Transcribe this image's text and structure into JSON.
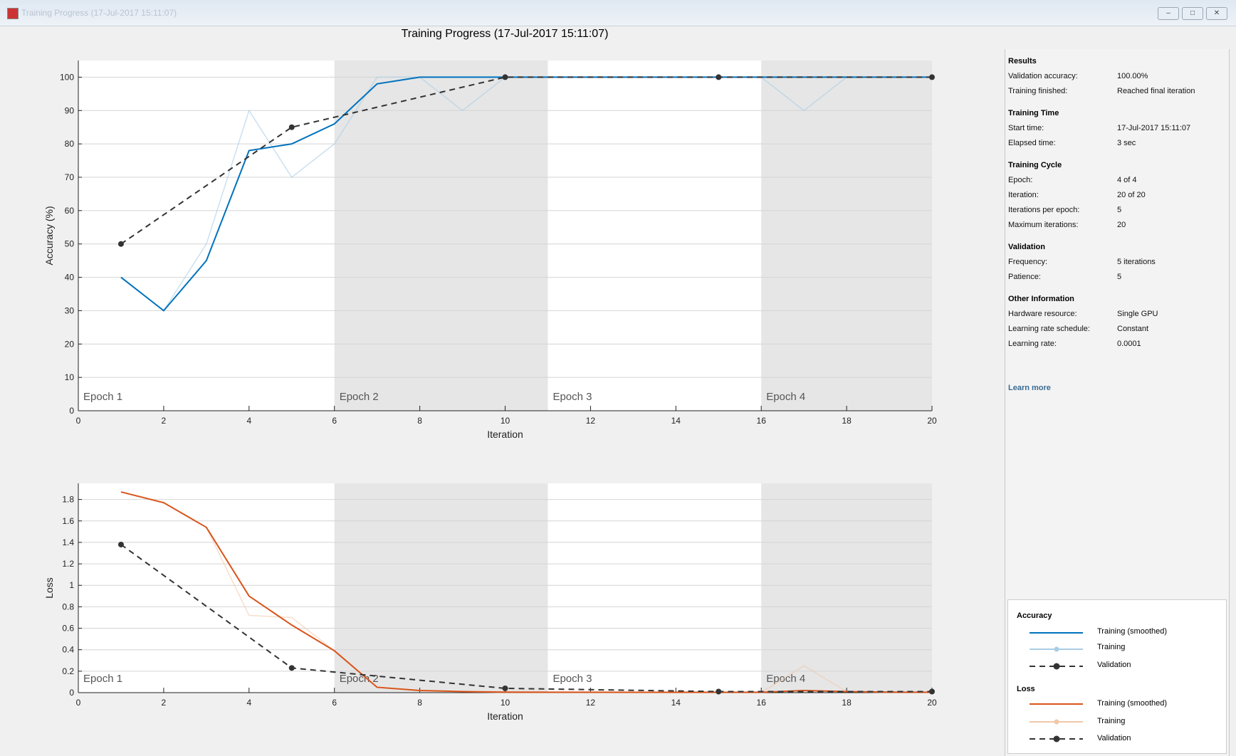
{
  "window": {
    "title": "Training Progress (17-Jul-2017 15:11:07)",
    "buttons": [
      "minimize",
      "maximize",
      "close"
    ]
  },
  "results": {
    "sections": [
      {
        "title": "Results",
        "rows": [
          [
            "Validation accuracy:",
            "100.00%"
          ],
          [
            "Training finished:",
            "Reached final iteration"
          ]
        ]
      },
      {
        "title": "Training Time",
        "rows": [
          [
            "Start time:",
            "17-Jul-2017 15:11:07"
          ],
          [
            "Elapsed time:",
            "3 sec"
          ]
        ]
      },
      {
        "title": "Training Cycle",
        "rows": [
          [
            "Epoch:",
            "4 of 4"
          ],
          [
            "Iteration:",
            "20 of 20"
          ],
          [
            "Iterations per epoch:",
            "5"
          ],
          [
            "Maximum iterations:",
            "20"
          ]
        ]
      },
      {
        "title": "Validation",
        "rows": [
          [
            "Frequency:",
            "5 iterations"
          ],
          [
            "Patience:",
            "5"
          ]
        ]
      },
      {
        "title": "Other Information",
        "rows": [
          [
            "Hardware resource:",
            "Single GPU"
          ],
          [
            "Learning rate schedule:",
            "Constant"
          ],
          [
            "Learning rate:",
            "0.0001"
          ]
        ]
      }
    ],
    "learn_more": "Learn more"
  },
  "legend": {
    "accuracy_title": "Accuracy",
    "loss_title": "Loss",
    "items": [
      "Training (smoothed)",
      "Training",
      "Validation"
    ],
    "colors": {
      "acc_smooth": "#0072bd",
      "acc_raw": "#a9cde6",
      "loss_smooth": "#d95319",
      "loss_raw": "#f0c8a8",
      "validation": "#333333"
    }
  },
  "chart_data": [
    {
      "type": "line",
      "title": "Training Progress (17-Jul-2017 15:11:07)",
      "xlabel": "Iteration",
      "ylabel": "Accuracy (%)",
      "xlim": [
        0,
        20
      ],
      "ylim": [
        0,
        105
      ],
      "xticks": [
        0,
        2,
        4,
        6,
        8,
        10,
        12,
        14,
        16,
        18,
        20
      ],
      "yticks": [
        0,
        10,
        20,
        30,
        40,
        50,
        60,
        70,
        80,
        90,
        100
      ],
      "epochs": [
        "Epoch 1",
        "Epoch 2",
        "Epoch 3",
        "Epoch 4"
      ],
      "series": [
        {
          "name": "Training (smoothed)",
          "x": [
            1,
            2,
            3,
            4,
            5,
            6,
            7,
            8,
            9,
            10,
            11,
            12,
            13,
            14,
            15,
            16,
            17,
            18,
            19,
            20
          ],
          "y": [
            40,
            30,
            45,
            78,
            80,
            86,
            98,
            100,
            100,
            100,
            100,
            100,
            100,
            100,
            100,
            100,
            100,
            100,
            100,
            100
          ]
        },
        {
          "name": "Training",
          "x": [
            1,
            2,
            3,
            4,
            5,
            6,
            7,
            8,
            9,
            10,
            11,
            12,
            13,
            14,
            15,
            16,
            17,
            18,
            19,
            20
          ],
          "y": [
            40,
            30,
            50,
            90,
            70,
            80,
            100,
            100,
            90,
            100,
            100,
            100,
            100,
            100,
            100,
            100,
            90,
            100,
            100,
            100
          ]
        },
        {
          "name": "Validation",
          "x": [
            1,
            5,
            10,
            15,
            20
          ],
          "y": [
            50,
            85,
            100,
            100,
            100
          ]
        }
      ]
    },
    {
      "type": "line",
      "xlabel": "Iteration",
      "ylabel": "Loss",
      "xlim": [
        0,
        20
      ],
      "ylim": [
        0,
        1.95
      ],
      "xticks": [
        0,
        2,
        4,
        6,
        8,
        10,
        12,
        14,
        16,
        18,
        20
      ],
      "yticks": [
        0,
        0.2,
        0.4,
        0.6,
        0.8,
        1,
        1.2,
        1.4,
        1.6,
        1.8
      ],
      "epochs": [
        "Epoch 1",
        "Epoch 2",
        "Epoch 3",
        "Epoch 4"
      ],
      "series": [
        {
          "name": "Training (smoothed)",
          "x": [
            1,
            2,
            3,
            4,
            5,
            6,
            7,
            8,
            9,
            10,
            11,
            12,
            13,
            14,
            15,
            16,
            17,
            18,
            19,
            20
          ],
          "y": [
            1.87,
            1.77,
            1.54,
            0.9,
            0.63,
            0.39,
            0.05,
            0.02,
            0.01,
            0.005,
            0.004,
            0.004,
            0.003,
            0.003,
            0.003,
            0.003,
            0.02,
            0.01,
            0.005,
            0.003
          ]
        },
        {
          "name": "Training",
          "x": [
            1,
            2,
            3,
            4,
            5,
            6,
            7,
            8,
            9,
            10,
            11,
            12,
            13,
            14,
            15,
            16,
            17,
            18,
            19,
            20
          ],
          "y": [
            1.87,
            1.77,
            1.54,
            0.72,
            0.7,
            0.39,
            0.05,
            0.02,
            0.01,
            0.0,
            0.0,
            0.0,
            0.0,
            0.0,
            0.0,
            0.0,
            0.25,
            0.01,
            0.0,
            0.0
          ]
        },
        {
          "name": "Validation",
          "x": [
            1,
            5,
            10,
            15,
            20
          ],
          "y": [
            1.38,
            0.23,
            0.04,
            0.01,
            0.01
          ]
        }
      ]
    }
  ]
}
